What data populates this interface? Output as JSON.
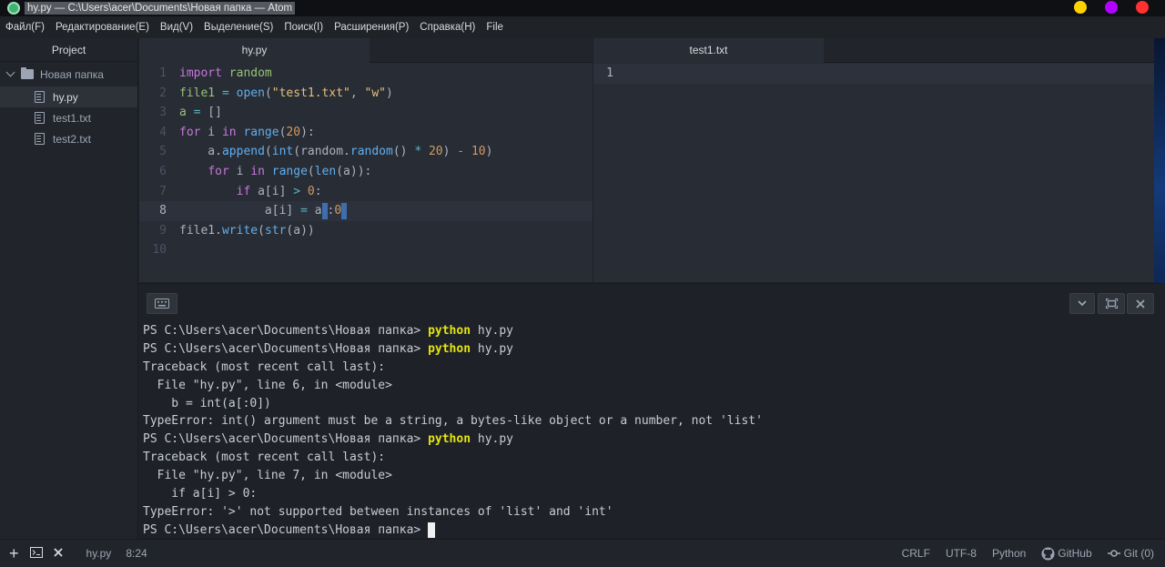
{
  "window": {
    "title": "hy.py — C:\\Users\\acer\\Documents\\Новая папка — Atom",
    "controls": [
      {
        "name": "minimize",
        "color": "#ffd300"
      },
      {
        "name": "maximize",
        "color": "#b300ff"
      },
      {
        "name": "close",
        "color": "#ff3030"
      }
    ]
  },
  "menu": [
    "Файл(F)",
    "Редактирование(E)",
    "Вид(V)",
    "Выделение(S)",
    "Поиск(I)",
    "Расширения(P)",
    "Справка(H)",
    "File"
  ],
  "tree": {
    "header": "Project",
    "folder": "Новая папка",
    "files": [
      "hy.py",
      "test1.txt",
      "test2.txt"
    ],
    "active_file": "hy.py"
  },
  "editor_left": {
    "tab": "hy.py",
    "line_numbers": [
      "1",
      "2",
      "3",
      "4",
      "5",
      "6",
      "7",
      "8",
      "9",
      "10"
    ],
    "current_line": "8"
  },
  "editor_right": {
    "tab": "test1.txt",
    "line_numbers": [
      "1"
    ]
  },
  "terminal": {
    "prompt": "PS C:\\Users\\acer\\Documents\\Новая папка> ",
    "command": "python",
    "command_arg": " hy.py",
    "traceback_header": "Traceback (most recent call last):",
    "frame1": "  File \"hy.py\", line 6, in <module>",
    "frame1_code": "    b = int(a[:0])",
    "error1": "TypeError: int() argument must be a string, a bytes-like object or a number, not 'list'",
    "frame2": "  File \"hy.py\", line 7, in <module>",
    "frame2_code": "    if a[i] > 0:",
    "error2": "TypeError: '>' not supported between instances of 'list' and 'int'"
  },
  "status": {
    "file": "hy.py",
    "cursor_position": "8:24",
    "line_ending": "CRLF",
    "encoding": "UTF-8",
    "grammar": "Python",
    "github": "GitHub",
    "git": "Git (0)"
  },
  "colors": {
    "keyword": "#c678dd",
    "string": "#e5c07b",
    "number": "#d19a66",
    "function": "#61afef",
    "python_command": "#e5e510"
  }
}
